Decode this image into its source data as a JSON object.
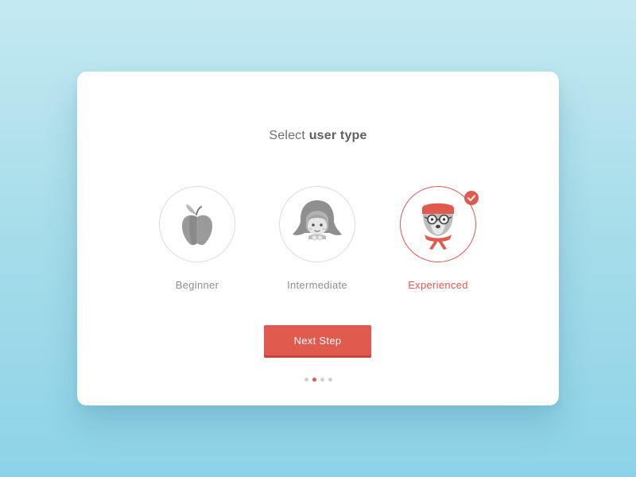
{
  "header": {
    "title_prefix": "Select",
    "title_bold": "user type"
  },
  "options": [
    {
      "label": "Beginner",
      "icon": "apple-icon",
      "selected": false
    },
    {
      "label": "Intermediate",
      "icon": "red-riding-hood-avatar-icon",
      "selected": false
    },
    {
      "label": "Experienced",
      "icon": "wolf-with-glasses-avatar-icon",
      "selected": true
    }
  ],
  "next_button": {
    "label": "Next Step"
  },
  "pagination": {
    "total": 4,
    "current": 2
  },
  "colors": {
    "accent": "#e05a4e",
    "text": "#6f6f6f",
    "inactive_label": "#8e8e8e",
    "background": "#a6dcea"
  }
}
